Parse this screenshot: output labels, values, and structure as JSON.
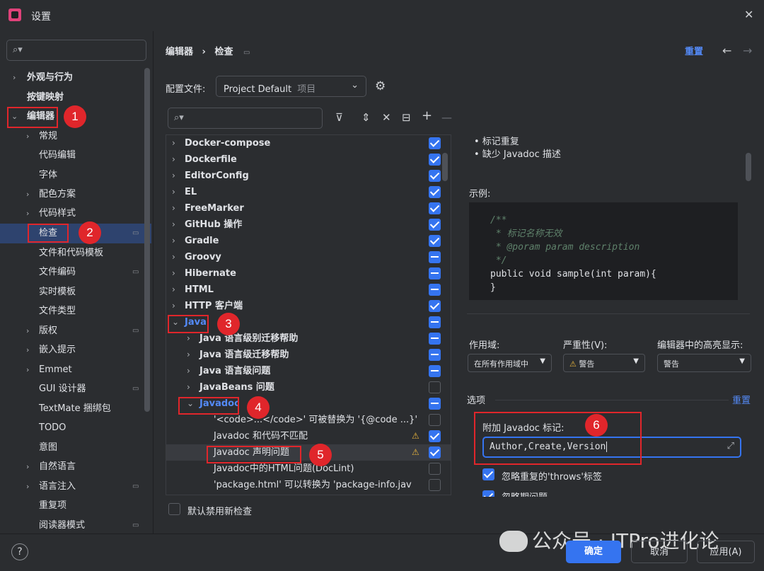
{
  "window": {
    "title": "设置",
    "close": "✕"
  },
  "sidebar": {
    "search_placeholder": "",
    "items": [
      {
        "label": "外观与行为",
        "bold": true
      },
      {
        "label": "按键映射",
        "bold": true
      },
      {
        "label": "编辑器",
        "bold": true,
        "expanded": true
      },
      {
        "label": "常规"
      },
      {
        "label": "代码编辑"
      },
      {
        "label": "字体"
      },
      {
        "label": "配色方案"
      },
      {
        "label": "代码样式"
      },
      {
        "label": "检查",
        "selected": true
      },
      {
        "label": "文件和代码模板"
      },
      {
        "label": "文件编码"
      },
      {
        "label": "实时模板"
      },
      {
        "label": "文件类型"
      },
      {
        "label": "版权"
      },
      {
        "label": "嵌入提示"
      },
      {
        "label": "Emmet"
      },
      {
        "label": "GUI 设计器"
      },
      {
        "label": "TextMate 捆绑包"
      },
      {
        "label": "TODO"
      },
      {
        "label": "意图"
      },
      {
        "label": "自然语言"
      },
      {
        "label": "语言注入"
      },
      {
        "label": "重复项"
      },
      {
        "label": "阅读器模式"
      }
    ]
  },
  "annotations": [
    "1",
    "2",
    "3",
    "4",
    "5",
    "6"
  ],
  "header": {
    "breadcrumb_parent": "编辑器",
    "breadcrumb_sep": "›",
    "breadcrumb_current": "检查",
    "reset": "重置"
  },
  "profile": {
    "label": "配置文件:",
    "value": "Project Default",
    "scope": "项目"
  },
  "tree": {
    "rows": [
      {
        "label": "Docker-compose",
        "state": "on"
      },
      {
        "label": "Dockerfile",
        "state": "on"
      },
      {
        "label": "EditorConfig",
        "state": "on"
      },
      {
        "label": "EL",
        "state": "on"
      },
      {
        "label": "FreeMarker",
        "state": "on"
      },
      {
        "label": "GitHub 操作",
        "state": "on"
      },
      {
        "label": "Gradle",
        "state": "on"
      },
      {
        "label": "Groovy",
        "state": "part"
      },
      {
        "label": "Hibernate",
        "state": "part"
      },
      {
        "label": "HTML",
        "state": "part"
      },
      {
        "label": "HTTP 客户端",
        "state": "on"
      },
      {
        "label": "Java",
        "state": "part"
      },
      {
        "label": "Java 语言级别迁移帮助",
        "state": "part"
      },
      {
        "label": "Java 语言级迁移帮助",
        "state": "part"
      },
      {
        "label": "Java 语言级问题",
        "state": "part"
      },
      {
        "label": "JavaBeans 问题",
        "state": "off"
      },
      {
        "label": "Javadoc",
        "state": "part"
      },
      {
        "label": "'<code>...</code>' 可被替换为 '{@code ...}'",
        "state": "off"
      },
      {
        "label": "Javadoc 和代码不匹配",
        "state": "on",
        "warn": "⚠"
      },
      {
        "label": "Javadoc 声明问题",
        "state": "on",
        "warn": "⚠"
      },
      {
        "label": "Javadoc中的HTML问题(DocLint)",
        "state": "off"
      },
      {
        "label": "'package.html' 可以转换为 'package-info.jav",
        "state": "off"
      }
    ],
    "default_disable_label": "默认禁用新检查"
  },
  "description": {
    "bullets": [
      "• 标记重复",
      "• 缺少 Javadoc 描述"
    ],
    "example_label": "示例:",
    "code": [
      "/**",
      " * 标记名称无效",
      " * @poram param description",
      " */",
      "public void sample(int param){",
      "}"
    ]
  },
  "options": {
    "scope_label": "作用域:",
    "scope_value": "在所有作用域中",
    "severity_label": "严重性(V):",
    "severity_value": "警告",
    "highlight_label": "编辑器中的高亮显示:",
    "highlight_value": "警告",
    "section_label": "选项",
    "reset": "重置",
    "tags_label": "附加 Javadoc 标记:",
    "tags_value": "Author,Create,Version",
    "ignore_throws": "忽略重复的'throws'标签",
    "ignore_period": "忽略期问题"
  },
  "footer": {
    "help": "?",
    "ok": "确定",
    "cancel": "取消",
    "apply": "应用(A)"
  },
  "watermark": "公众号 · ITPro进化论",
  "colors": {
    "accent": "#3574f0",
    "annotation": "#e0262b",
    "link": "#548af7"
  }
}
